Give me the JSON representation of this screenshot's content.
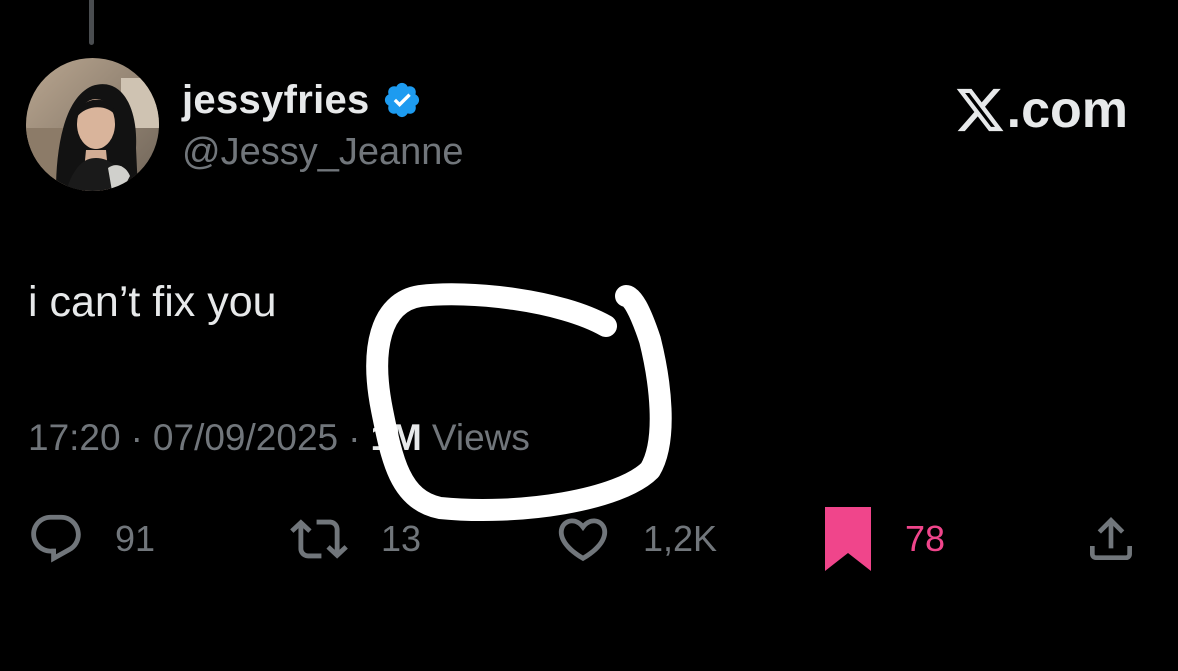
{
  "tweet": {
    "author": {
      "display_name": "jessyfries",
      "handle": "@Jessy_Jeanne",
      "verified": true
    },
    "brand": {
      "domain": ".com",
      "logo_icon": "x-logo-icon"
    },
    "text": "i can’t fix you",
    "time": "17:20",
    "separator": "·",
    "date": "07/09/2025",
    "views_count": "1M",
    "views_label": "Views",
    "actions": {
      "reply": {
        "icon": "reply-icon",
        "count": "91"
      },
      "repost": {
        "icon": "repost-icon",
        "count": "13"
      },
      "like": {
        "icon": "heart-icon",
        "count": "1,2K"
      },
      "bookmark": {
        "icon": "bookmark-icon",
        "count": "78",
        "active": true
      },
      "share": {
        "icon": "share-icon"
      }
    }
  },
  "colors": {
    "background": "#000000",
    "text_primary": "#e7e9ea",
    "text_secondary": "#71767b",
    "verified_blue": "#1d9bf0",
    "bookmark_pink": "#f0458b",
    "annotation_white": "#ffffff"
  }
}
